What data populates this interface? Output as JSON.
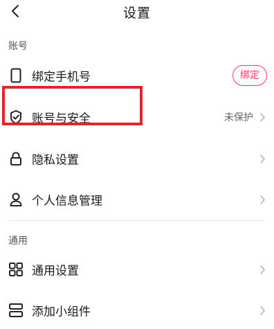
{
  "header": {
    "title": "设置"
  },
  "sections": [
    {
      "title": "账号",
      "items": [
        {
          "label": "绑定手机号",
          "icon": "phone-icon",
          "action_label": "绑定"
        },
        {
          "label": "账号与安全",
          "icon": "shield-check-icon",
          "status": "未保护"
        },
        {
          "label": "隐私设置",
          "icon": "lock-icon"
        },
        {
          "label": "个人信息管理",
          "icon": "person-icon"
        }
      ]
    },
    {
      "title": "通用",
      "items": [
        {
          "label": "通用设置",
          "icon": "grid-icon"
        },
        {
          "label": "添加小组件",
          "icon": "widget-icon"
        }
      ]
    }
  ],
  "colors": {
    "accent": "#ff3366",
    "annotation": "#e0262b"
  }
}
